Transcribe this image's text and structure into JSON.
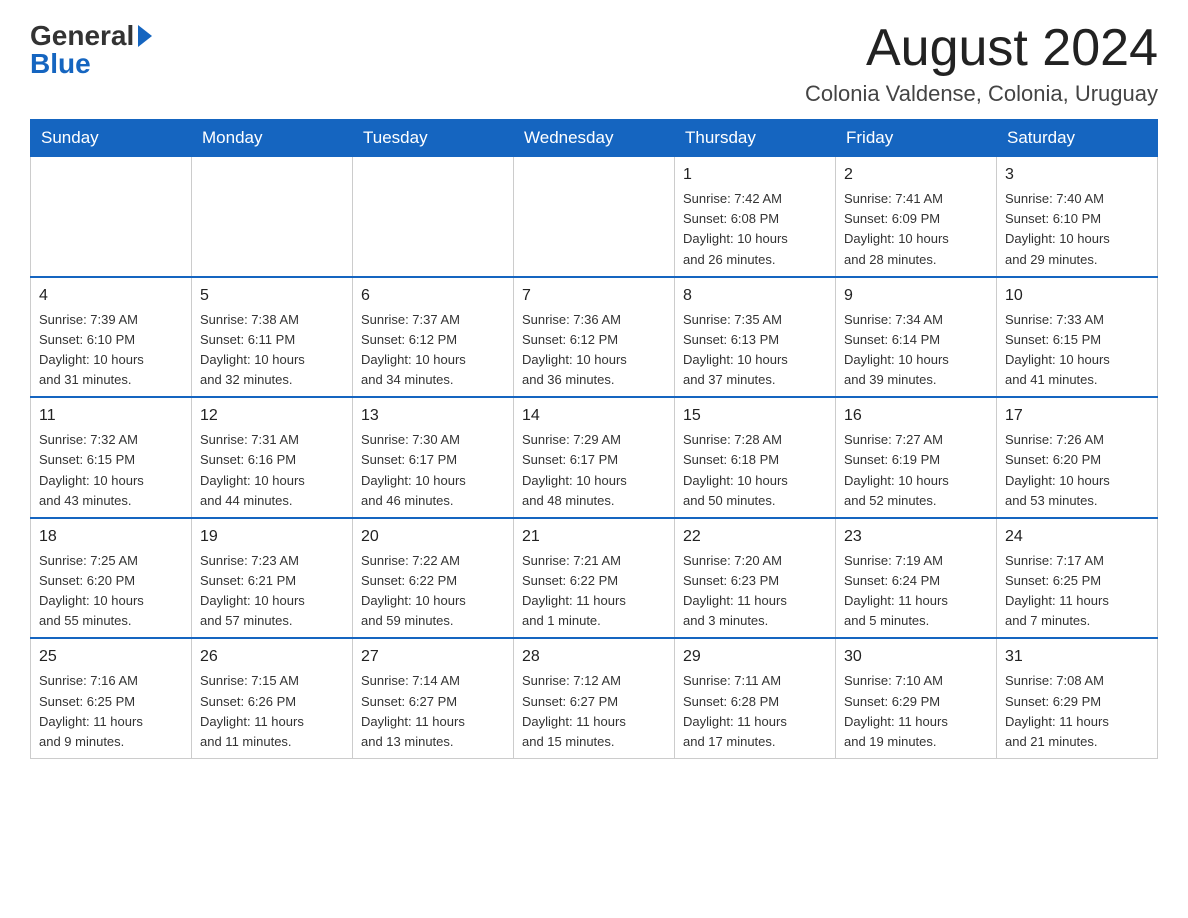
{
  "header": {
    "logo_general": "General",
    "logo_blue": "Blue",
    "month_title": "August 2024",
    "location": "Colonia Valdense, Colonia, Uruguay"
  },
  "days_of_week": [
    "Sunday",
    "Monday",
    "Tuesday",
    "Wednesday",
    "Thursday",
    "Friday",
    "Saturday"
  ],
  "weeks": [
    [
      {
        "day": "",
        "info": ""
      },
      {
        "day": "",
        "info": ""
      },
      {
        "day": "",
        "info": ""
      },
      {
        "day": "",
        "info": ""
      },
      {
        "day": "1",
        "info": "Sunrise: 7:42 AM\nSunset: 6:08 PM\nDaylight: 10 hours\nand 26 minutes."
      },
      {
        "day": "2",
        "info": "Sunrise: 7:41 AM\nSunset: 6:09 PM\nDaylight: 10 hours\nand 28 minutes."
      },
      {
        "day": "3",
        "info": "Sunrise: 7:40 AM\nSunset: 6:10 PM\nDaylight: 10 hours\nand 29 minutes."
      }
    ],
    [
      {
        "day": "4",
        "info": "Sunrise: 7:39 AM\nSunset: 6:10 PM\nDaylight: 10 hours\nand 31 minutes."
      },
      {
        "day": "5",
        "info": "Sunrise: 7:38 AM\nSunset: 6:11 PM\nDaylight: 10 hours\nand 32 minutes."
      },
      {
        "day": "6",
        "info": "Sunrise: 7:37 AM\nSunset: 6:12 PM\nDaylight: 10 hours\nand 34 minutes."
      },
      {
        "day": "7",
        "info": "Sunrise: 7:36 AM\nSunset: 6:12 PM\nDaylight: 10 hours\nand 36 minutes."
      },
      {
        "day": "8",
        "info": "Sunrise: 7:35 AM\nSunset: 6:13 PM\nDaylight: 10 hours\nand 37 minutes."
      },
      {
        "day": "9",
        "info": "Sunrise: 7:34 AM\nSunset: 6:14 PM\nDaylight: 10 hours\nand 39 minutes."
      },
      {
        "day": "10",
        "info": "Sunrise: 7:33 AM\nSunset: 6:15 PM\nDaylight: 10 hours\nand 41 minutes."
      }
    ],
    [
      {
        "day": "11",
        "info": "Sunrise: 7:32 AM\nSunset: 6:15 PM\nDaylight: 10 hours\nand 43 minutes."
      },
      {
        "day": "12",
        "info": "Sunrise: 7:31 AM\nSunset: 6:16 PM\nDaylight: 10 hours\nand 44 minutes."
      },
      {
        "day": "13",
        "info": "Sunrise: 7:30 AM\nSunset: 6:17 PM\nDaylight: 10 hours\nand 46 minutes."
      },
      {
        "day": "14",
        "info": "Sunrise: 7:29 AM\nSunset: 6:17 PM\nDaylight: 10 hours\nand 48 minutes."
      },
      {
        "day": "15",
        "info": "Sunrise: 7:28 AM\nSunset: 6:18 PM\nDaylight: 10 hours\nand 50 minutes."
      },
      {
        "day": "16",
        "info": "Sunrise: 7:27 AM\nSunset: 6:19 PM\nDaylight: 10 hours\nand 52 minutes."
      },
      {
        "day": "17",
        "info": "Sunrise: 7:26 AM\nSunset: 6:20 PM\nDaylight: 10 hours\nand 53 minutes."
      }
    ],
    [
      {
        "day": "18",
        "info": "Sunrise: 7:25 AM\nSunset: 6:20 PM\nDaylight: 10 hours\nand 55 minutes."
      },
      {
        "day": "19",
        "info": "Sunrise: 7:23 AM\nSunset: 6:21 PM\nDaylight: 10 hours\nand 57 minutes."
      },
      {
        "day": "20",
        "info": "Sunrise: 7:22 AM\nSunset: 6:22 PM\nDaylight: 10 hours\nand 59 minutes."
      },
      {
        "day": "21",
        "info": "Sunrise: 7:21 AM\nSunset: 6:22 PM\nDaylight: 11 hours\nand 1 minute."
      },
      {
        "day": "22",
        "info": "Sunrise: 7:20 AM\nSunset: 6:23 PM\nDaylight: 11 hours\nand 3 minutes."
      },
      {
        "day": "23",
        "info": "Sunrise: 7:19 AM\nSunset: 6:24 PM\nDaylight: 11 hours\nand 5 minutes."
      },
      {
        "day": "24",
        "info": "Sunrise: 7:17 AM\nSunset: 6:25 PM\nDaylight: 11 hours\nand 7 minutes."
      }
    ],
    [
      {
        "day": "25",
        "info": "Sunrise: 7:16 AM\nSunset: 6:25 PM\nDaylight: 11 hours\nand 9 minutes."
      },
      {
        "day": "26",
        "info": "Sunrise: 7:15 AM\nSunset: 6:26 PM\nDaylight: 11 hours\nand 11 minutes."
      },
      {
        "day": "27",
        "info": "Sunrise: 7:14 AM\nSunset: 6:27 PM\nDaylight: 11 hours\nand 13 minutes."
      },
      {
        "day": "28",
        "info": "Sunrise: 7:12 AM\nSunset: 6:27 PM\nDaylight: 11 hours\nand 15 minutes."
      },
      {
        "day": "29",
        "info": "Sunrise: 7:11 AM\nSunset: 6:28 PM\nDaylight: 11 hours\nand 17 minutes."
      },
      {
        "day": "30",
        "info": "Sunrise: 7:10 AM\nSunset: 6:29 PM\nDaylight: 11 hours\nand 19 minutes."
      },
      {
        "day": "31",
        "info": "Sunrise: 7:08 AM\nSunset: 6:29 PM\nDaylight: 11 hours\nand 21 minutes."
      }
    ]
  ]
}
